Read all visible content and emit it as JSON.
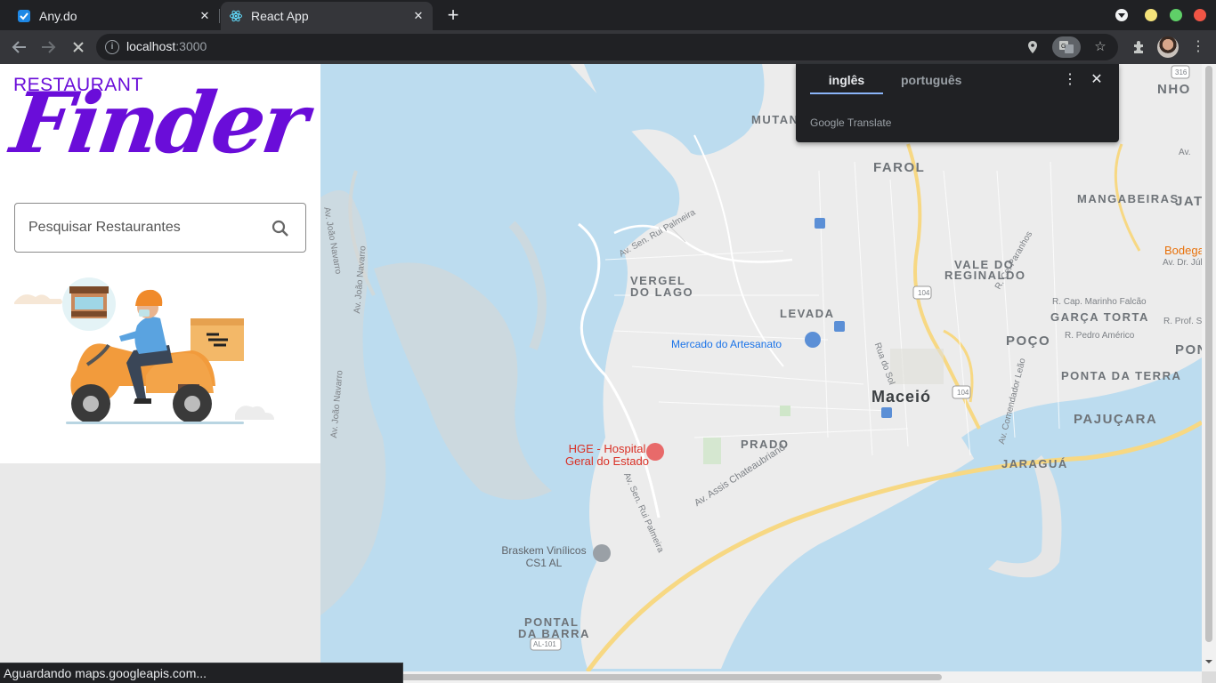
{
  "browser": {
    "tabs": [
      {
        "title": "Any.do",
        "favicon": "anydo-check-icon",
        "active": false,
        "favicon_color": "#1e88e5"
      },
      {
        "title": "React App",
        "favicon": "react-logo-icon",
        "active": true,
        "favicon_color": "#61dafb"
      }
    ],
    "url_host": "localhost",
    "url_port": ":3000",
    "status_text": "Aguardando maps.googleapis.com..."
  },
  "app": {
    "logo_small": "RESTAURANT",
    "logo_big": "Finder",
    "brand_color": "#6a0dd9",
    "search": {
      "placeholder": "Pesquisar Restaurantes",
      "value": ""
    }
  },
  "translate_popup": {
    "tabs": [
      "inglês",
      "português"
    ],
    "active_tab": "inglês",
    "brand": "Google Translate"
  },
  "map": {
    "areas": [
      "FAROL",
      "MUTAN",
      "VALE DO",
      "REGINALDO",
      "MANGABEIRAS",
      "VERGEL",
      "DO LAGO",
      "LEVADA",
      "POÇO",
      "GARÇA TORTA",
      "PONTA DA TERRA",
      "PAJUÇARA",
      "PRADO",
      "JARAGUÁ",
      "PONTAL",
      "DA BARRA",
      "NHO",
      "JAT",
      "PONT"
    ],
    "city": "Maceió",
    "streets": [
      "Av. Sen. Rui Palmeira",
      "Av. João Navarro",
      "Av. João Navarro",
      "Av. João Navarro",
      "R. Cel Paranhos",
      "R. Cap. Marinho Falcão",
      "R. Prof. S",
      "R. Pedro Américo",
      "Rua do Sol",
      "Av. Comendador Leão",
      "Av. Assis Chateaubriand",
      "Av. Sen. Rui Palmeira",
      "Av. Dr. Júl",
      "Av. "
    ],
    "pois": {
      "market": "Mercado do Artesanato",
      "hospital": "HGE - Hospital Geral do Estado",
      "braskem": "Braskem Vinílicos CS1 AL",
      "bodega": "Bodega"
    },
    "shields": [
      "104",
      "104",
      "316",
      "AL-101"
    ]
  }
}
